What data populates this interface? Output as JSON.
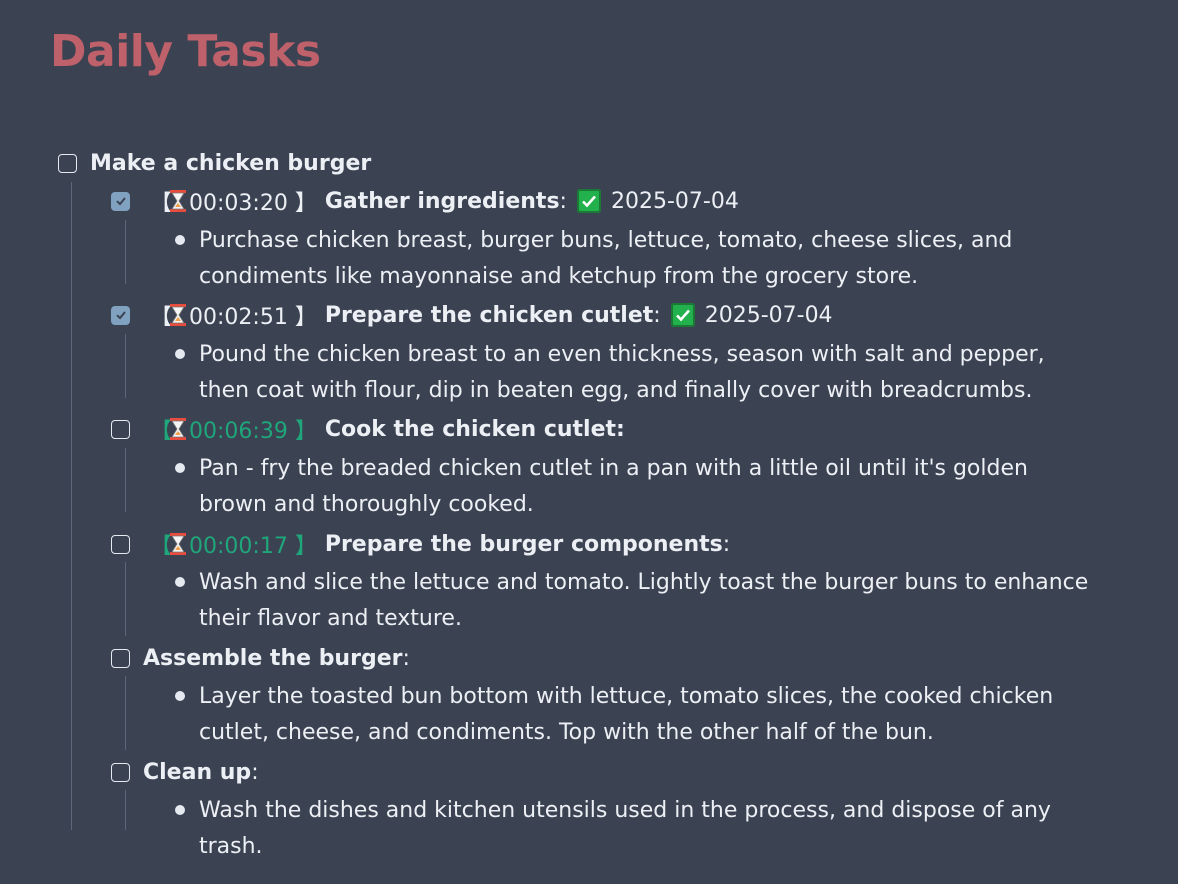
{
  "page": {
    "title": "Daily Tasks"
  },
  "task": {
    "label": "Make a chicken burger",
    "subtasks": [
      {
        "timer": "【00:03:20 】",
        "label": "Gather ingredients",
        "suffix": ":",
        "done_date": "2025-07-04",
        "checked": true,
        "note": "Purchase chicken breast, burger buns, lettuce, tomato, cheese slices, and condiments like mayonnaise and ketchup from the grocery store."
      },
      {
        "timer": "【00:02:51 】",
        "label": "Prepare the chicken cutlet",
        "suffix": ":",
        "done_date": "2025-07-04",
        "checked": true,
        "note": "Pound the chicken breast to an even thickness, season with salt and pepper, then coat with flour, dip in beaten egg, and finally cover with breadcrumbs."
      },
      {
        "timer": "【00:06:39 】",
        "label": "Cook the chicken cutlet:",
        "checked": false,
        "note": "Pan - fry the breaded chicken cutlet in a pan with a little oil until it's golden brown and thoroughly cooked."
      },
      {
        "timer": "【00:00:17 】",
        "label": "Prepare the burger components",
        "suffix": ":",
        "checked": false,
        "note": "Wash and slice the lettuce and tomato. Lightly toast the burger buns to enhance their flavor and texture."
      },
      {
        "label": "Assemble the burger",
        "suffix": ":",
        "checked": false,
        "note": "Layer the toasted bun bottom with lettuce, tomato slices, the cooked chicken cutlet, cheese, and condiments. Top with the other half of the bun."
      },
      {
        "label": "Clean up",
        "suffix": ":",
        "checked": false,
        "note": "Wash the dishes and kitchen utensils used in the process, and dispose of any trash."
      }
    ]
  },
  "colors": {
    "background": "#3b4252",
    "title": "#bf616a",
    "checked": "#81a1c1",
    "running_timer": "#1fa67a",
    "done_badge": "#22b14c"
  },
  "icons": {
    "timer": "hourglass-icon",
    "done": "check-mark-button-icon"
  }
}
